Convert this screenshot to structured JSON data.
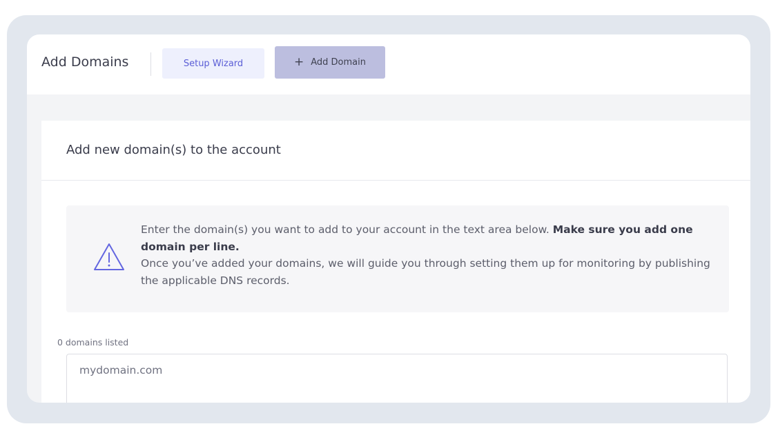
{
  "header": {
    "title": "Add Domains",
    "wizard_label": "Setup Wizard",
    "add_label": "Add Domain"
  },
  "card": {
    "title": "Add new domain(s) to the account"
  },
  "notice": {
    "text_1": "Enter the domain(s) you want to add to your account in the text area below. ",
    "bold": "Make sure you add one domain per line.",
    "text_2": "Once you’ve added your domains, we will guide you through setting them up for monitoring by publishing the applicable DNS records."
  },
  "domains": {
    "count_label": "0 domains listed",
    "placeholder": "mydomain.com"
  },
  "colors": {
    "accent": "#5b5ed6",
    "add_button_bg": "#bcbedf",
    "wizard_button_bg": "#eef0fd"
  },
  "icons": {
    "add": "plus-icon",
    "notice": "warning-triangle-icon"
  }
}
